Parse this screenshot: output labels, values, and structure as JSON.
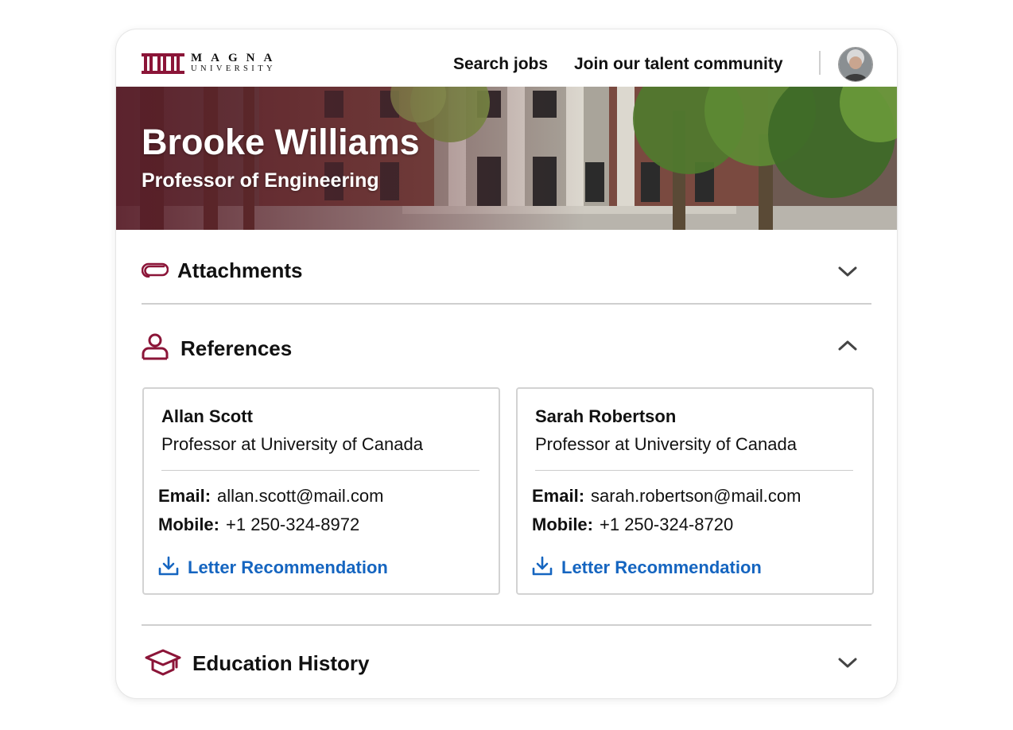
{
  "header": {
    "logo_line1": "MAGNA",
    "logo_line2": "UNIVERSITY",
    "nav": [
      "Search jobs",
      "Join our talent community"
    ],
    "avatar_icon": "user-avatar"
  },
  "profile": {
    "name": "Brooke Williams",
    "title": "Professor of Engineering"
  },
  "sections": {
    "attachments": {
      "label": "Attachments",
      "icon": "paperclip-icon",
      "expanded": false
    },
    "references": {
      "label": "References",
      "icon": "person-icon",
      "expanded": true
    },
    "education": {
      "label": "Education History",
      "icon": "graduation-cap-icon",
      "expanded": false
    }
  },
  "references": [
    {
      "name": "Allan Scott",
      "role": "Professor at University of Canada",
      "email_label": "Email:",
      "email": "allan.scott@mail.com",
      "mobile_label": "Mobile:",
      "mobile": "+1 250-324-8972",
      "link": "Letter Recommendation"
    },
    {
      "name": "Sarah Robertson",
      "role": "Professor at University of Canada",
      "email_label": "Email:",
      "email": "sarah.robertson@mail.com",
      "mobile_label": "Mobile:",
      "mobile": "+1 250-324-8720",
      "link": "Letter Recommendation"
    }
  ],
  "colors": {
    "brand": "#8b1538",
    "link": "#1565c0",
    "text": "#111111",
    "divider": "#cfcfcf"
  }
}
